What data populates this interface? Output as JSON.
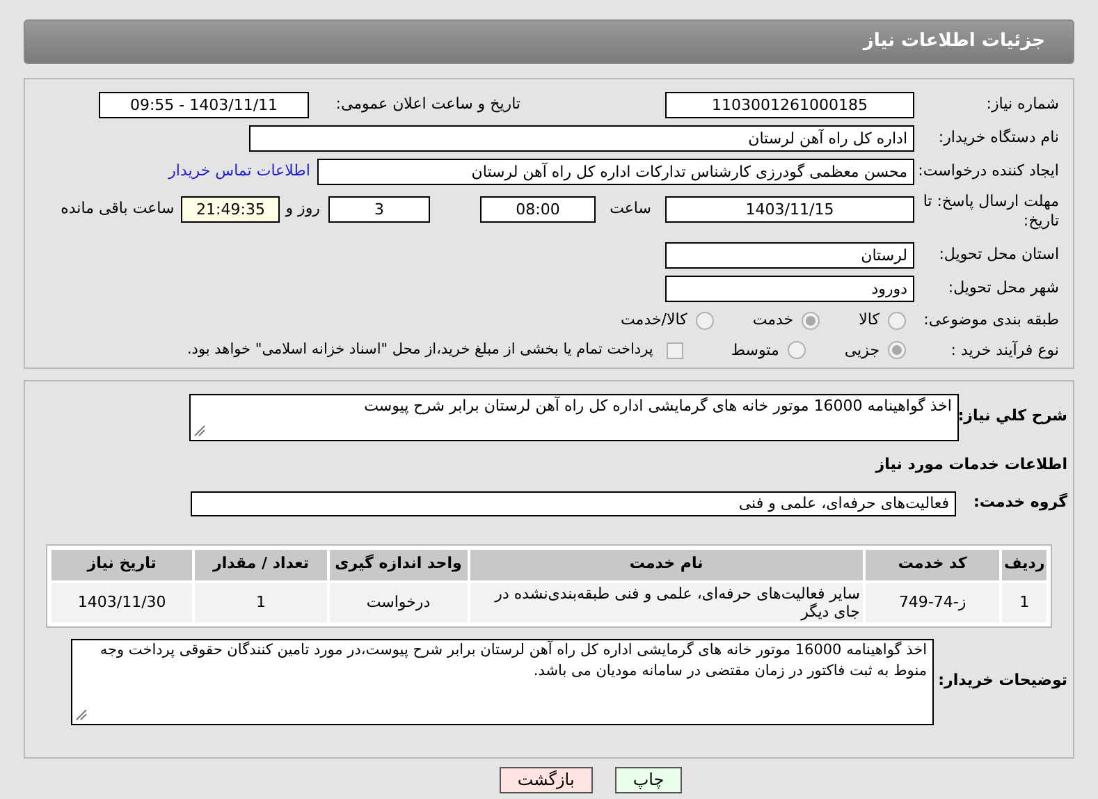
{
  "header": {
    "title": "جزئیات اطلاعات نیاز"
  },
  "need_number": {
    "label": "شماره نیاز:",
    "value": "1103001261000185"
  },
  "announce_date": {
    "label": "تاریخ و ساعت اعلان عمومی:",
    "value": "1403/11/11 - 09:55"
  },
  "buyer_org": {
    "label": "نام دستگاه خریدار:",
    "value": "اداره کل راه آهن لرستان"
  },
  "requester": {
    "label": "ایجاد کننده درخواست:",
    "value": "محسن معظمی گودرزی کارشناس تدارکات اداره کل راه آهن لرستان",
    "link": "اطلاعات تماس خریدار"
  },
  "deadline": {
    "label": "مهلت ارسال پاسخ: تا تاریخ:",
    "date": "1403/11/15",
    "time_label": "ساعت",
    "time": "08:00",
    "days": "3",
    "days_label": "روز و",
    "remaining": "21:49:35",
    "remaining_label": "ساعت باقی مانده"
  },
  "province": {
    "label": "استان محل تحویل:",
    "value": "لرستان"
  },
  "city": {
    "label": "شهر محل تحویل:",
    "value": "دورود"
  },
  "category": {
    "label": "طبقه بندی موضوعی:",
    "options": [
      {
        "label": "کالا",
        "selected": false
      },
      {
        "label": "خدمت",
        "selected": true
      },
      {
        "label": "کالا/خدمت",
        "selected": false
      }
    ]
  },
  "process": {
    "label": "نوع فرآیند خرید :",
    "options": [
      {
        "label": "جزیی",
        "selected": true
      },
      {
        "label": "متوسط",
        "selected": false
      }
    ],
    "payment": {
      "checked": false,
      "label": "پرداخت تمام یا بخشی از مبلغ خرید،از محل \"اسناد خزانه اسلامی\" خواهد بود."
    }
  },
  "summary": {
    "label": "شرح کلي نیاز:",
    "value": "اخذ گواهینامه 16000 موتور خانه های گرمایشی اداره کل راه آهن لرستان برابر شرح پیوست"
  },
  "services_heading": "اطلاعات خدمات مورد نیاز",
  "service_group": {
    "label": "گروه خدمت:",
    "value": "فعالیت‌های حرفه‌ای، علمی و فنی"
  },
  "table": {
    "columns": [
      "ردیف",
      "کد خدمت",
      "نام خدمت",
      "واحد اندازه گیری",
      "تعداد / مقدار",
      "تاریخ نیاز"
    ],
    "rows": [
      [
        "1",
        "ز-74-749",
        "سایر فعالیت‌های حرفه‌ای، علمی و فنی طبقه‌بندی‌نشده در جای دیگر",
        "درخواست",
        "1",
        "1403/11/30"
      ]
    ]
  },
  "buyer_notes": {
    "label": "توضیحات خریدار:",
    "value": "اخذ گواهینامه 16000 موتور خانه های گرمایشی اداره کل راه آهن لرستان برابر شرح پیوست،در مورد تامین کنندگان حقوقی پرداخت وجه منوط به ثبت فاکتور در زمان مقتضی در سامانه مودیان می باشد."
  },
  "buttons": [
    {
      "label": "چاپ",
      "kind": "print"
    },
    {
      "label": "بازگشت",
      "kind": "back"
    }
  ]
}
